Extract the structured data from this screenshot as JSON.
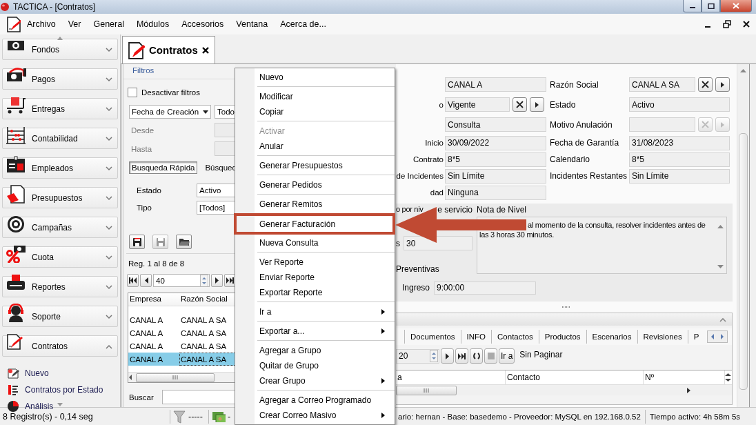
{
  "window": {
    "title": "TACTICA - [Contratos]"
  },
  "menu_bar": {
    "items": [
      "Archivo",
      "Ver",
      "General",
      "Módulos",
      "Accesorios",
      "Ventana",
      "Acerca de..."
    ]
  },
  "sidebar": {
    "sections": [
      {
        "label": "Fondos",
        "expanded": false
      },
      {
        "label": "Pagos",
        "expanded": false
      },
      {
        "label": "Entregas",
        "expanded": false
      },
      {
        "label": "Contabilidad",
        "expanded": false
      },
      {
        "label": "Empleados",
        "expanded": false
      },
      {
        "label": "Presupuestos",
        "expanded": false
      },
      {
        "label": "Campañas",
        "expanded": false
      },
      {
        "label": "Cuota",
        "expanded": false
      },
      {
        "label": "Reportes",
        "expanded": false
      },
      {
        "label": "Soporte",
        "expanded": false
      },
      {
        "label": "Contratos",
        "expanded": true,
        "children": [
          {
            "label": "Nuevo"
          },
          {
            "label": "Contratos por Estado"
          },
          {
            "label": "Análisis"
          }
        ]
      }
    ]
  },
  "document_tabs": [
    {
      "label": "Contratos",
      "selected": true
    }
  ],
  "filters": {
    "title": "Filtros",
    "disable_filters": {
      "label": "Desactivar filtros",
      "checked": false
    },
    "date_field": {
      "value": "Fecha de Creación"
    },
    "period": {
      "value": "Todo"
    },
    "from_label": "Desde",
    "to_label": "Hasta",
    "tabs": [
      {
        "label": "Busqueda Rápida",
        "selected": true
      },
      {
        "label": "Búsqued",
        "selected": false
      }
    ],
    "fields": [
      {
        "label": "Estado",
        "value": "Activo"
      },
      {
        "label": "Tipo",
        "value": "[Todos]"
      }
    ],
    "toolbar": [
      {
        "kind": "save",
        "disabled": false
      },
      {
        "kind": "save",
        "disabled": true
      },
      {
        "kind": "open",
        "disabled": false
      }
    ],
    "record_info": "Reg. 1 al 8 de 8",
    "page_size": "40",
    "table": {
      "columns": [
        "Empresa",
        "Razón Social"
      ],
      "rows": [
        {
          "cells": [
            "CANAL A",
            "CANAL A SA"
          ],
          "selected": false
        },
        {
          "cells": [
            "CANAL A",
            "CANAL A SA"
          ],
          "selected": false
        },
        {
          "cells": [
            "CANAL A",
            "CANAL A SA"
          ],
          "selected": false
        },
        {
          "cells": [
            "CANAL A",
            "CANAL A SA"
          ],
          "selected": true
        }
      ]
    },
    "search_label": "Buscar"
  },
  "detail": {
    "rows": [
      [
        {
          "value": "CANAL A"
        },
        {
          "label": "Razón Social",
          "value": "CANAL A SA",
          "lookup": true,
          "disabled": false
        }
      ],
      [
        {
          "label": "o",
          "value": "Vigente",
          "lookup": true,
          "disabled": false
        },
        {
          "label": "Estado",
          "value": "Activo"
        }
      ],
      [
        {
          "value": "Consulta"
        },
        {
          "label": "Motivo Anulación",
          "lookup": true,
          "disabled": true
        }
      ],
      [
        {
          "label": "Inicio",
          "value": "30/09/2022"
        },
        {
          "label": "Fecha de Garantía",
          "value": "31/08/2023"
        }
      ],
      [
        {
          "label": "Contrato",
          "value": "8*5"
        },
        {
          "label": "Calendario",
          "value": "8*5"
        }
      ],
      [
        {
          "label": "de Incidentes",
          "value": "Sin Límite"
        },
        {
          "label": "Incidentes Restantes",
          "value": "Sin Límite"
        }
      ],
      [
        {
          "label": "dad",
          "value": "Ninguna"
        }
      ]
    ],
    "service_level": {
      "label_start": "o por niv",
      "label_end": "e servicio",
      "hours_label": "s",
      "hours": "30",
      "preventive_label": "Preventivas",
      "entry_label": "Ingreso",
      "entry_time": "9:00:00",
      "note_label": "Nota de Nivel",
      "note_lines": [
        "al momento de la consulta, resolver incidentes antes de",
        "las 3 horas 30 minutos."
      ]
    }
  },
  "related": {
    "tabs": [
      {
        "label": "Documentos",
        "selected": false
      },
      {
        "label": "INFO",
        "selected": false
      },
      {
        "label": "Contactos",
        "selected": false
      },
      {
        "label": "Productos",
        "selected": false
      },
      {
        "label": "Escenarios",
        "selected": false
      },
      {
        "label": "Revisiones",
        "selected": false
      },
      {
        "label": "P",
        "selected": false
      }
    ],
    "page_size": "20",
    "goto_label": "Ir a",
    "paging": "Sin Paginar",
    "columns": [
      "a",
      "Contacto",
      "Nº"
    ]
  },
  "context_menu": {
    "groups": [
      [
        {
          "label": "Nuevo",
          "disabled": false,
          "submenu": false,
          "highlighted": false
        }
      ],
      [
        {
          "label": "Modificar",
          "disabled": false,
          "submenu": false,
          "highlighted": false
        },
        {
          "label": "Copiar",
          "disabled": false,
          "submenu": false,
          "highlighted": false
        }
      ],
      [
        {
          "label": "Activar",
          "disabled": true,
          "submenu": false,
          "highlighted": false
        },
        {
          "label": "Anular",
          "disabled": false,
          "submenu": false,
          "highlighted": false
        }
      ],
      [
        {
          "label": "Generar Presupuestos",
          "disabled": false,
          "submenu": false,
          "highlighted": false
        }
      ],
      [
        {
          "label": "Generar Pedidos",
          "disabled": false,
          "submenu": false,
          "highlighted": false
        }
      ],
      [
        {
          "label": "Generar Remitos",
          "disabled": false,
          "submenu": false,
          "highlighted": false
        }
      ],
      [
        {
          "label": "Generar Facturación",
          "disabled": false,
          "submenu": false,
          "highlighted": true
        }
      ],
      [
        {
          "label": "Nueva Consulta",
          "disabled": false,
          "submenu": false,
          "highlighted": false
        }
      ],
      [
        {
          "label": "Ver Reporte",
          "disabled": false,
          "submenu": false,
          "highlighted": false
        },
        {
          "label": "Enviar Reporte",
          "disabled": false,
          "submenu": false,
          "highlighted": false
        },
        {
          "label": "Exportar Reporte",
          "disabled": false,
          "submenu": false,
          "highlighted": false
        }
      ],
      [
        {
          "label": "Ir a",
          "disabled": false,
          "submenu": true,
          "highlighted": false
        }
      ],
      [
        {
          "label": "Exportar a...",
          "disabled": false,
          "submenu": true,
          "highlighted": false
        }
      ],
      [
        {
          "label": "Agregar a Grupo",
          "disabled": false,
          "submenu": false,
          "highlighted": false
        },
        {
          "label": "Quitar de Grupo",
          "disabled": false,
          "submenu": false,
          "highlighted": false
        },
        {
          "label": "Crear Grupo",
          "disabled": false,
          "submenu": true,
          "highlighted": false
        }
      ],
      [
        {
          "label": "Agregar a Correo Programado",
          "disabled": false,
          "submenu": false,
          "highlighted": false
        },
        {
          "label": "Crear Correo Masivo",
          "disabled": false,
          "submenu": true,
          "highlighted": false
        }
      ]
    ]
  },
  "status_bar": {
    "records": "8 Registro(s) - 0,14 seg",
    "filter": "-----",
    "profile": "-",
    "connection": "ario: hernan - Base: basedemo - Proveedor: MySQL en 192.168.0.52",
    "uptime": "Tiempo activo: 4h 58m 5s"
  }
}
